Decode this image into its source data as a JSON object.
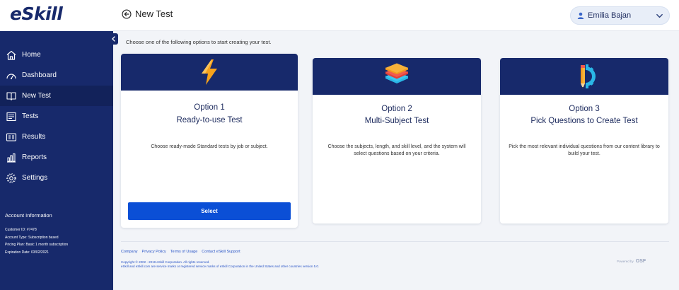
{
  "app": {
    "logo": "eSkill"
  },
  "header": {
    "title": "New Test",
    "user_name": "Emilia Bajan"
  },
  "sidebar": {
    "items": [
      {
        "label": "Home",
        "icon": "home-icon"
      },
      {
        "label": "Dashboard",
        "icon": "dashboard-icon"
      },
      {
        "label": "New Test",
        "icon": "book-icon",
        "active": true
      },
      {
        "label": "Tests",
        "icon": "tests-icon"
      },
      {
        "label": "Results",
        "icon": "results-icon"
      },
      {
        "label": "Reports",
        "icon": "reports-icon"
      },
      {
        "label": "Settings",
        "icon": "settings-icon"
      }
    ],
    "account": {
      "title": "Account Information",
      "rows": [
        "Customer ID:  #7478",
        "Account Type:  Subscription based",
        "Pricing Plan:  Basic 1 month subscription",
        "Expiration Date:  03/02/2021"
      ]
    }
  },
  "main": {
    "intro": "Choose one of the following options to start creating your test.",
    "options": [
      {
        "option": "Option 1",
        "name": "Ready-to-use Test",
        "desc": "Choose ready-made Standard tests by job or subject.",
        "button": "Select",
        "icon": "lightning-icon"
      },
      {
        "option": "Option 2",
        "name": "Multi-Subject Test",
        "desc": "Choose the subjects, length, and skill level, and the system will select questions based on your criteria.",
        "icon": "layers-icon"
      },
      {
        "option": "Option 3",
        "name": "Pick Questions to Create Test",
        "desc": "Pick the most relevant individual questions from our content library to build your test.",
        "icon": "pencil-gear-icon"
      }
    ]
  },
  "footer": {
    "links": [
      "Company",
      "Privacy Policy",
      "Terms of Usage",
      "Contact eSkill Support"
    ],
    "copyright_1": "Copyright © 2002 - 2019 eSkill Corporation. All rights reserved.",
    "copyright_2": "eSkill and eSkill.com are service marks or registered service marks of eSkill Corporation in the United States and other countries version 5.0.",
    "powered_by": "Powered by",
    "powered_brand": "OSF"
  },
  "colors": {
    "navy": "#17296b",
    "button_blue": "#0b4fd6",
    "link_blue": "#2a55c6",
    "icon_orange": "#f7a21b"
  }
}
